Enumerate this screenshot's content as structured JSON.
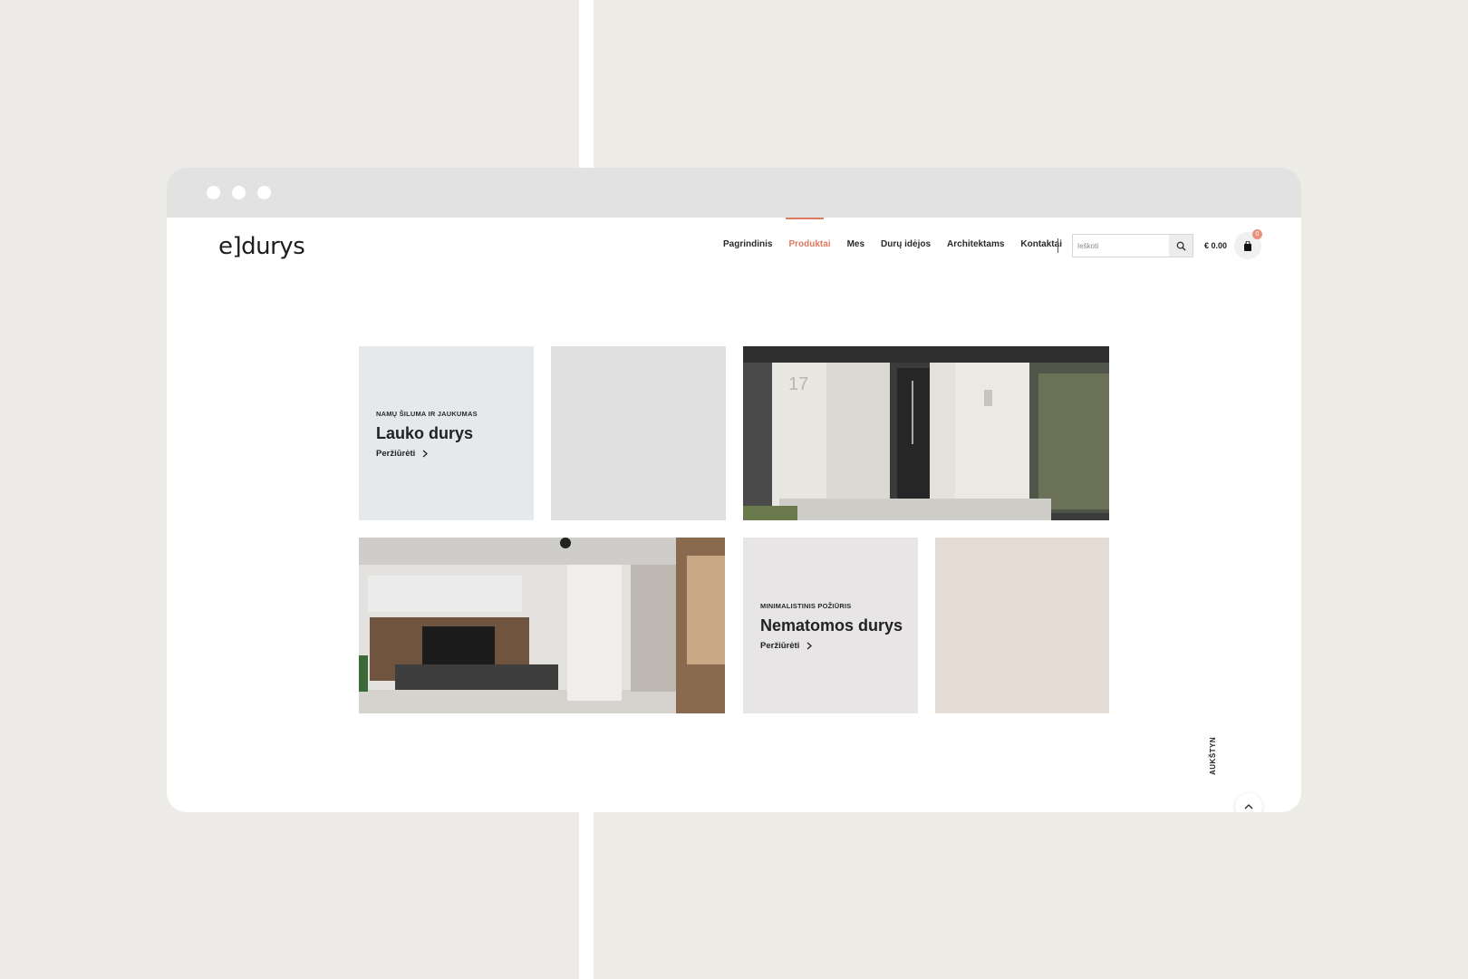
{
  "logo": "e]durys",
  "nav": {
    "items": [
      "Pagrindinis",
      "Produktai",
      "Mes",
      "Durų idėjos",
      "Architektams",
      "Kontaktai"
    ],
    "active": "Produktai"
  },
  "search": {
    "placeholder": "Ieškoti"
  },
  "cart": {
    "total": "€ 0.00",
    "count": "0"
  },
  "tiles": {
    "exterior": {
      "kicker": "NAMŲ ŠILUMA IR JAUKUMAS",
      "title": "Lauko durys",
      "link": "Peržiūrėti"
    },
    "hidden": {
      "kicker": "MINIMALISTINIS POŽIŪRIS",
      "title": "Nematomos durys",
      "link": "Peržiūrėti"
    },
    "house_number": "17"
  },
  "back_to_top": {
    "label": "AUKŠTYN"
  },
  "colors": {
    "accent": "#e07a5f",
    "tile_blue": "#e6e9ec",
    "tile_gray": "#e0e0e0",
    "tile_lightgray": "#e7e5e6",
    "tile_beige": "#e6dcd6"
  }
}
